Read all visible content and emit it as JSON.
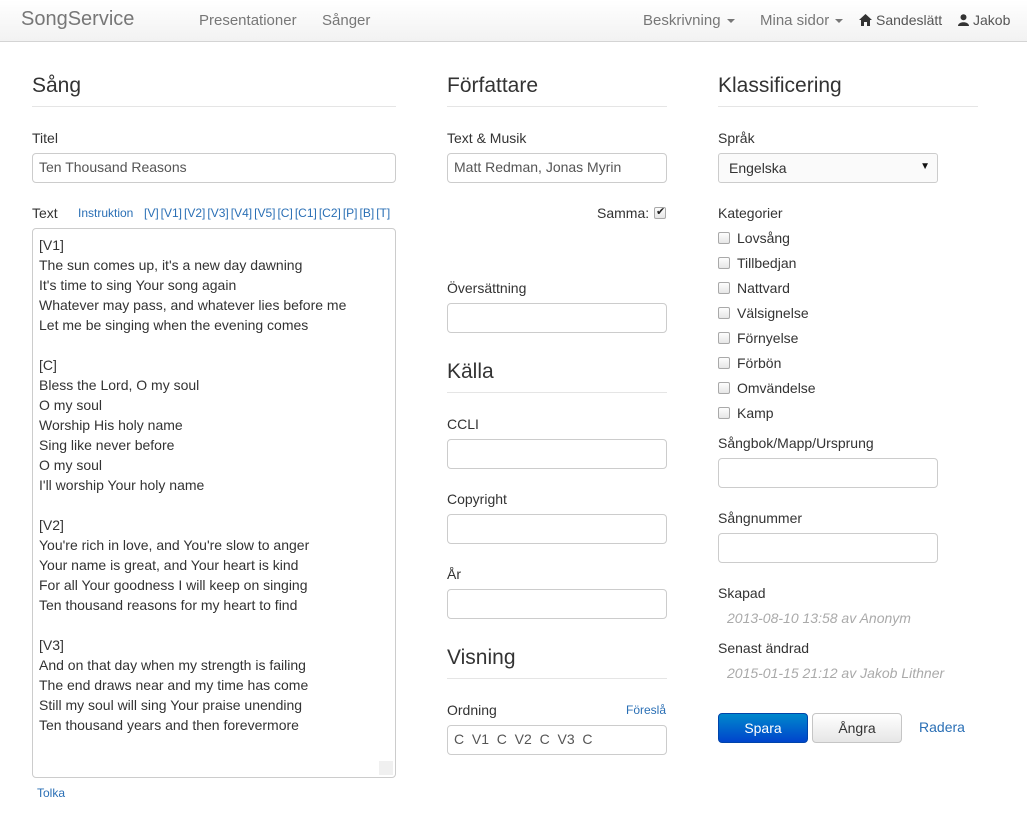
{
  "navbar": {
    "brand": "SongService",
    "left_items": [
      "Presentationer",
      "Sånger"
    ],
    "menu_description": "Beskrivning",
    "menu_my_pages": "Mina sidor",
    "home_label": "Sandeslätt",
    "user_label": "Jakob",
    "icons": {
      "home": "home-icon",
      "user": "user-icon"
    }
  },
  "song": {
    "heading": "Sång",
    "title_label": "Titel",
    "title_value": "Ten Thousand Reasons",
    "text_label": "Text",
    "instruction_link": "Instruktion",
    "markers": [
      "[V]",
      "[V1]",
      "[V2]",
      "[V3]",
      "[V4]",
      "[V5]",
      "[C]",
      "[C1]",
      "[C2]",
      "[P]",
      "[B]",
      "[T]"
    ],
    "lyrics": [
      "[V1]",
      "The sun comes up, it's a new day dawning",
      "It's time to sing Your song again",
      "Whatever may pass, and whatever lies before me",
      "Let me be singing when the evening comes",
      "",
      "[C]",
      "Bless the Lord, O my soul",
      "O my soul",
      "Worship His holy name",
      "Sing like never before",
      "O my soul",
      "I'll worship Your holy name",
      "",
      "[V2]",
      "You're rich in love, and You're slow to anger",
      "Your name is great, and Your heart is kind",
      "For all Your goodness I will keep on singing",
      "Ten thousand reasons for my heart to find",
      "",
      "[V3]",
      "And on that day when my strength is failing",
      "The end draws near and my time has come",
      "Still my soul will sing Your praise unending",
      "Ten thousand years and then forevermore"
    ],
    "interpret_link": "Tolka"
  },
  "author": {
    "heading": "Författare",
    "text_music_label": "Text & Musik",
    "text_music_value": "Matt Redman, Jonas Myrin",
    "same_label": "Samma:",
    "same_checked": true,
    "translation_label": "Översättning",
    "translation_value": ""
  },
  "source": {
    "heading": "Källa",
    "ccli_label": "CCLI",
    "ccli_value": "",
    "copyright_label": "Copyright",
    "copyright_value": "",
    "year_label": "År",
    "year_value": ""
  },
  "display": {
    "heading": "Visning",
    "order_label": "Ordning",
    "suggest_link": "Föreslå",
    "order_value": "C  V1  C  V2  C  V3  C"
  },
  "classification": {
    "heading": "Klassificering",
    "language_label": "Språk",
    "language_value": "Engelska",
    "categories_label": "Kategorier",
    "categories": [
      "Lovsång",
      "Tillbedjan",
      "Nattvard",
      "Välsignelse",
      "Förnyelse",
      "Förbön",
      "Omvändelse",
      "Kamp"
    ],
    "songbook_label": "Sångbok/Mapp/Ursprung",
    "songbook_value": "",
    "song_number_label": "Sångnummer",
    "song_number_value": "",
    "created_label": "Skapad",
    "created_value": "2013-08-10 13:58 av Anonym",
    "modified_label": "Senast ändrad",
    "modified_value": "2015-01-15 21:12 av Jakob Lithner"
  },
  "actions": {
    "save": "Spara",
    "undo": "Ångra",
    "delete": "Radera"
  },
  "colors": {
    "primary": "#0055cc",
    "link": "#2a6fb5",
    "muted": "#aaaaaa"
  }
}
